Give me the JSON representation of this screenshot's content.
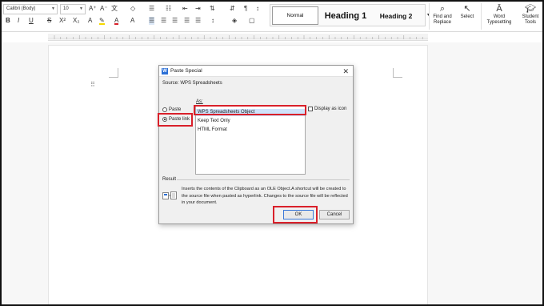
{
  "ribbon": {
    "font_name": "Calibri (Body)",
    "font_size": "10",
    "styles": {
      "normal": "Normal",
      "heading1": "Heading 1",
      "heading2": "Heading 2"
    },
    "find_replace": "Find and Replace",
    "select": "Select",
    "word_typesetting": "Word Typesetting",
    "student_tools": "Student Tools"
  },
  "dialog": {
    "title": "Paste Special",
    "close": "✕",
    "source": "Source: WPS Spreadsheets",
    "as_label": "As:",
    "paste_label": "Paste",
    "paste_link_label": "Paste link",
    "paste_link_selected": true,
    "list_items": [
      "WPS Spreadsheets Object",
      "Keep Text Only",
      "HTML Format"
    ],
    "selected_index": 0,
    "display_as_icon": "Display as icon",
    "result_label": "Result",
    "result_text": "Inserts the contents of the Clipboard as an OLE Object.A shortcut will be created to the source file when pasted as hyperlink. Changes to the source file will be reflected in your document.",
    "ok": "OK",
    "cancel": "Cancel"
  },
  "colors": {
    "highlight": "#d9202a",
    "selection": "#cfe3fb",
    "accent": "#2b6fd6"
  }
}
